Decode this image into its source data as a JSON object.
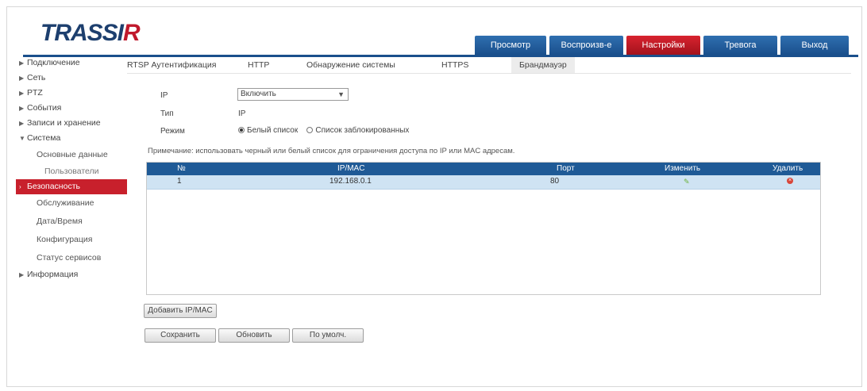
{
  "brand": {
    "logo_main": "TRASSI",
    "logo_accent": "R"
  },
  "nav": {
    "tabs": [
      "Просмотр",
      "Воспроизв-е",
      "Настройки",
      "Тревога",
      "Выход"
    ],
    "active_index": 2
  },
  "sidebar": {
    "items": [
      {
        "label": "Подключение",
        "level": 0,
        "expanded": false
      },
      {
        "label": "Сеть",
        "level": 0,
        "expanded": false
      },
      {
        "label": "PTZ",
        "level": 0,
        "expanded": false
      },
      {
        "label": "События",
        "level": 0,
        "expanded": false
      },
      {
        "label": "Записи и хранение",
        "level": 0,
        "expanded": false
      },
      {
        "label": "Система",
        "level": 0,
        "expanded": true
      },
      {
        "label": "Основные данные",
        "level": 1
      },
      {
        "label": "Пользователи",
        "level": 2
      },
      {
        "label": "Безопасность",
        "level": 1,
        "active": true
      },
      {
        "label": "Обслуживание",
        "level": 1
      },
      {
        "label": "Дата/Время",
        "level": 1
      },
      {
        "label": "Конфигурация",
        "level": 1
      },
      {
        "label": "Статус сервисов",
        "level": 1
      },
      {
        "label": "Информация",
        "level": 0,
        "expanded": false
      }
    ]
  },
  "subtabs": {
    "items": [
      "RTSP Аутентификация",
      "HTTP",
      "Обнаружение системы",
      "HTTPS",
      "Брандмауэр"
    ],
    "active_index": 4
  },
  "form": {
    "select_label": "IP",
    "select_value": "Включить",
    "type_label": "Тип",
    "type_value": "IP",
    "mode_label": "Режим",
    "radio_1": "Белый список",
    "radio_2": "Список заблокированных",
    "note": "Примечание: использовать черный или белый список для ограничения доступа по IP или MAC адресам."
  },
  "table": {
    "columns": [
      "№",
      "IP/MAC",
      "Порт",
      "Изменить",
      "Удалить"
    ],
    "rows": [
      {
        "num": "1",
        "address": "192.168.0.1",
        "port": "80"
      }
    ]
  },
  "buttons": {
    "add": "Добавить IP/MAC",
    "apply": "Сохранить",
    "refresh": "Обновить",
    "default": "По умолч."
  },
  "colors": {
    "nav_active": "#c8202c",
    "nav_tab": "#1f5a96",
    "table_header": "#1f5a96",
    "row_selected": "#cfe3f3"
  }
}
